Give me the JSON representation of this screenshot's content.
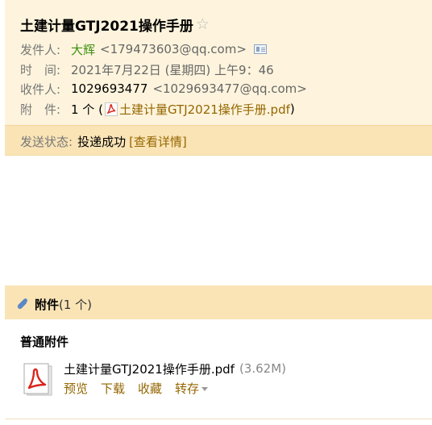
{
  "email": {
    "subject": "土建计量GTJ2021操作手册",
    "labels": {
      "from": "发件人:",
      "time": "时　间:",
      "to": "收件人:",
      "attachment": "附　件:"
    },
    "from": {
      "name": "大辉",
      "address": "<179473603@qq.com>"
    },
    "time": "2021年7月22日 (星期四) 上午9：46",
    "to": {
      "name": "1029693477",
      "address": "<1029693477@qq.com>"
    },
    "attachment_summary": {
      "count_prefix": "1 个 (",
      "file": "土建计量GTJ2021操作手册.pdf",
      "suffix": ")"
    },
    "status": {
      "label": "发送状态:",
      "value": "投递成功",
      "detail_link": "[查看详情]"
    }
  },
  "attachments": {
    "header_title": "附件",
    "header_count": "(1 个)",
    "section_title": "普通附件",
    "files": [
      {
        "name": "土建计量GTJ2021操作手册.pdf",
        "size": "(3.62M)",
        "actions": [
          "预览",
          "下载",
          "收藏",
          "转存"
        ]
      }
    ]
  },
  "colors": {
    "header_bg": "#fef4dd",
    "status_bg": "#fae4b6",
    "link": "#946600",
    "sender": "#3d8f10"
  },
  "icons": {
    "star": "star-icon",
    "vcard": "contact-card-icon",
    "pdf": "pdf-icon",
    "clip": "paperclip-icon"
  }
}
